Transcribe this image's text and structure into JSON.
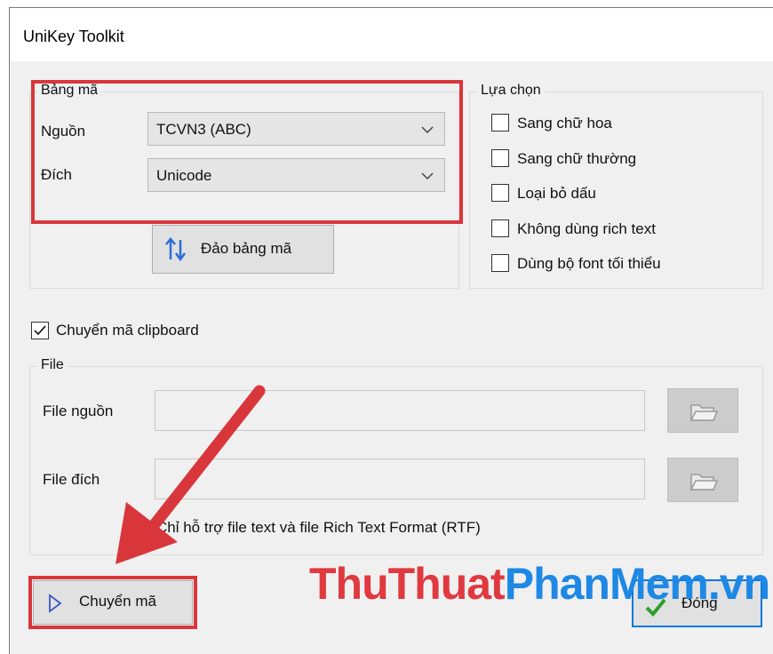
{
  "window": {
    "title": "UniKey Toolkit"
  },
  "encoding_table": {
    "legend": "Bảng mã",
    "source_label": "Nguồn",
    "source_value": "TCVN3 (ABC)",
    "target_label": "Đích",
    "target_value": "Unicode",
    "swap_button": "Đảo bảng mã"
  },
  "options": {
    "legend": "Lựa chọn",
    "items": [
      {
        "label": "Sang chữ hoa",
        "checked": false
      },
      {
        "label": "Sang chữ thường",
        "checked": false
      },
      {
        "label": "Loại bỏ dấu",
        "checked": false
      },
      {
        "label": "Không dùng rich text",
        "checked": false
      },
      {
        "label": "Dùng bộ font tối thiểu",
        "checked": false
      }
    ]
  },
  "clipboard": {
    "label": "Chuyển mã clipboard",
    "checked": true
  },
  "file": {
    "legend": "File",
    "source_label": "File nguồn",
    "source_value": "",
    "target_label": "File đích",
    "target_value": "",
    "note": "Chỉ hỗ trợ file text và file Rich Text Format (RTF)"
  },
  "actions": {
    "convert": "Chuyển mã",
    "close": "Đóng"
  },
  "watermark": {
    "part1": "ThuThuat",
    "part2": "PhanMem.vn"
  },
  "colors": {
    "highlight": "#d9363b",
    "accent": "#1e88e5",
    "check_green": "#2e9e2e"
  },
  "icons": [
    "swap-arrows-icon",
    "folder-open-icon",
    "play-triangle-icon",
    "green-check-icon",
    "chevron-down-icon"
  ]
}
